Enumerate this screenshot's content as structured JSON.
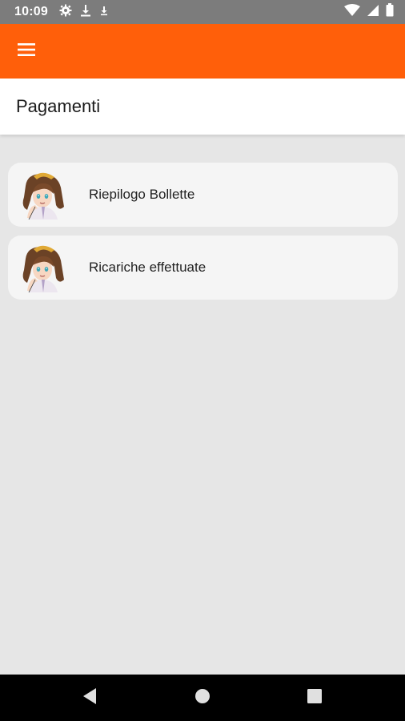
{
  "status_bar": {
    "time": "10:09",
    "left_icons": [
      "settings-icon",
      "download-icon",
      "download-small-icon"
    ],
    "right_icons": [
      "wifi-icon",
      "signal-icon",
      "battery-icon"
    ]
  },
  "app_bar": {
    "color": "#ff5f0a",
    "menu_icon": "hamburger-menu-icon"
  },
  "header": {
    "title": "Pagamenti"
  },
  "list": {
    "items": [
      {
        "label": "Riepilogo Bollette",
        "avatar": "character-avatar"
      },
      {
        "label": "Ricariche effettuate",
        "avatar": "character-avatar"
      }
    ]
  },
  "nav_bar": {
    "buttons": [
      "back-icon",
      "home-icon",
      "recents-icon"
    ]
  }
}
